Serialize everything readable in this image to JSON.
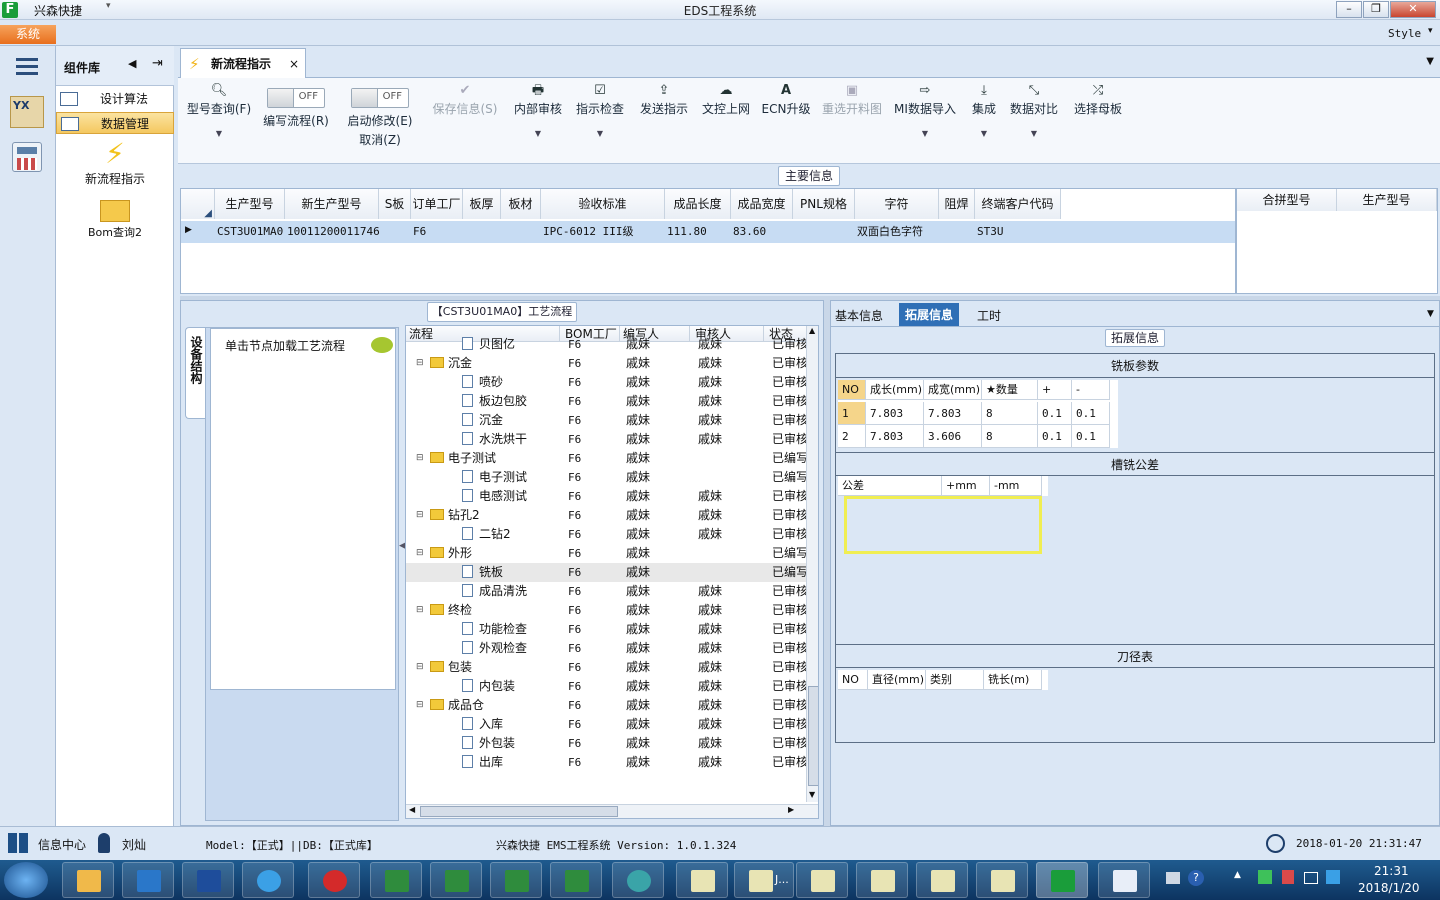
{
  "window": {
    "title": "EDS工程系统",
    "app_name": "兴森快捷",
    "style_label": "Style"
  },
  "menu": {
    "system": "系统"
  },
  "nav": {
    "header": "组件库",
    "items": [
      {
        "label": "设计算法"
      },
      {
        "label": "数据管理"
      }
    ],
    "tiles": [
      {
        "label": "新流程指示"
      },
      {
        "label": "Bom查询2"
      }
    ]
  },
  "tab": {
    "label": "新流程指示",
    "close": "×"
  },
  "toolbar": {
    "model_query": "型号查询(F)",
    "toggle_write": {
      "state": "OFF",
      "label": "编写流程(R)"
    },
    "toggle_start": {
      "state": "OFF",
      "label": "启动修改(E)",
      "sub": "取消(Z)"
    },
    "save": "保存信息(S)",
    "internal_review": "内部审核",
    "check": "指示检查",
    "send": "发送指示",
    "upload": "文控上网",
    "ecn": "ECN升级",
    "reselect": "重选开料图",
    "mi_import": "MI数据导入",
    "integrate": "集成",
    "compare": "数据对比",
    "select_board": "选择母板"
  },
  "main_info": {
    "title": "主要信息",
    "columns": [
      "生产型号",
      "新生产型号",
      "S板",
      "订单工厂",
      "板厚",
      "板材",
      "验收标准",
      "成品长度",
      "成品宽度",
      "PNL规格",
      "字符",
      "阻焊",
      "终端客户代码"
    ],
    "row": [
      "CST3U01MA0",
      "10011200011746",
      "",
      "F6",
      "",
      "",
      "IPC-6012 III级",
      "111.80",
      "83.60",
      "",
      "双面白色字符",
      "",
      "ST3U"
    ],
    "side_columns": [
      "合拼型号",
      "生产型号"
    ]
  },
  "process": {
    "title": "【CST3U01MA0】工艺流程",
    "side_tab": "设备结构",
    "hint": "单击节点加载工艺流程",
    "columns": [
      "流程",
      "BOM工厂",
      "编写人",
      "审核人",
      "状态"
    ],
    "rows": [
      {
        "name": "贝图亿",
        "level": 2,
        "type": "file",
        "bom": "F6",
        "writer": "戚妹",
        "reviewer": "戚妹",
        "status": "已审核"
      },
      {
        "name": "沉金",
        "level": 1,
        "type": "folder",
        "bom": "F6",
        "writer": "戚妹",
        "reviewer": "戚妹",
        "status": "已审核"
      },
      {
        "name": "喷砂",
        "level": 2,
        "type": "file",
        "bom": "F6",
        "writer": "戚妹",
        "reviewer": "戚妹",
        "status": "已审核"
      },
      {
        "name": "板边包胶",
        "level": 2,
        "type": "file",
        "bom": "F6",
        "writer": "戚妹",
        "reviewer": "戚妹",
        "status": "已审核"
      },
      {
        "name": "沉金",
        "level": 2,
        "type": "file",
        "bom": "F6",
        "writer": "戚妹",
        "reviewer": "戚妹",
        "status": "已审核"
      },
      {
        "name": "水洗烘干",
        "level": 2,
        "type": "file",
        "bom": "F6",
        "writer": "戚妹",
        "reviewer": "戚妹",
        "status": "已审核"
      },
      {
        "name": "电子测试",
        "level": 1,
        "type": "folder",
        "bom": "F6",
        "writer": "戚妹",
        "reviewer": "",
        "status": "已编写"
      },
      {
        "name": "电子测试",
        "level": 2,
        "type": "file",
        "bom": "F6",
        "writer": "戚妹",
        "reviewer": "",
        "status": "已编写"
      },
      {
        "name": "电感测试",
        "level": 2,
        "type": "file",
        "bom": "F6",
        "writer": "戚妹",
        "reviewer": "戚妹",
        "status": "已审核"
      },
      {
        "name": "钻孔2",
        "level": 1,
        "type": "folder",
        "bom": "F6",
        "writer": "戚妹",
        "reviewer": "戚妹",
        "status": "已审核"
      },
      {
        "name": "二钻2",
        "level": 2,
        "type": "file",
        "bom": "F6",
        "writer": "戚妹",
        "reviewer": "戚妹",
        "status": "已审核"
      },
      {
        "name": "外形",
        "level": 1,
        "type": "folder",
        "bom": "F6",
        "writer": "戚妹",
        "reviewer": "",
        "status": "已编写"
      },
      {
        "name": "铣板",
        "level": 2,
        "type": "file",
        "bom": "F6",
        "writer": "戚妹",
        "reviewer": "",
        "status": "已编写"
      },
      {
        "name": "成品清洗",
        "level": 2,
        "type": "file",
        "bom": "F6",
        "writer": "戚妹",
        "reviewer": "戚妹",
        "status": "已审核"
      },
      {
        "name": "终检",
        "level": 1,
        "type": "folder",
        "bom": "F6",
        "writer": "戚妹",
        "reviewer": "戚妹",
        "status": "已审核"
      },
      {
        "name": "功能检查",
        "level": 2,
        "type": "file",
        "bom": "F6",
        "writer": "戚妹",
        "reviewer": "戚妹",
        "status": "已审核"
      },
      {
        "name": "外观检查",
        "level": 2,
        "type": "file",
        "bom": "F6",
        "writer": "戚妹",
        "reviewer": "戚妹",
        "status": "已审核"
      },
      {
        "name": "包装",
        "level": 1,
        "type": "folder",
        "bom": "F6",
        "writer": "戚妹",
        "reviewer": "戚妹",
        "status": "已审核"
      },
      {
        "name": "内包装",
        "level": 2,
        "type": "file",
        "bom": "F6",
        "writer": "戚妹",
        "reviewer": "戚妹",
        "status": "已审核"
      },
      {
        "name": "成品仓",
        "level": 1,
        "type": "folder",
        "bom": "F6",
        "writer": "戚妹",
        "reviewer": "戚妹",
        "status": "已审核"
      },
      {
        "name": "入库",
        "level": 2,
        "type": "file",
        "bom": "F6",
        "writer": "戚妹",
        "reviewer": "戚妹",
        "status": "已审核"
      },
      {
        "name": "外包装",
        "level": 2,
        "type": "file",
        "bom": "F6",
        "writer": "戚妹",
        "reviewer": "戚妹",
        "status": "已审核"
      },
      {
        "name": "出库",
        "level": 2,
        "type": "file",
        "bom": "F6",
        "writer": "戚妹",
        "reviewer": "戚妹",
        "status": "已审核"
      }
    ]
  },
  "right_panel": {
    "tabs": [
      "基本信息",
      "拓展信息",
      "工时"
    ],
    "group_title": "拓展信息",
    "board_params": {
      "title": "铣板参数",
      "columns": [
        "NO",
        "成长(mm)",
        "成宽(mm)",
        "★数量",
        "+",
        "-"
      ],
      "rows": [
        [
          "1",
          "7.803",
          "7.803",
          "8",
          "0.1",
          "0.1"
        ],
        [
          "2",
          "7.803",
          "3.606",
          "8",
          "0.1",
          "0.1"
        ]
      ]
    },
    "tolerance": {
      "title": "槽铣公差",
      "columns": [
        "公差",
        "+mm",
        "-mm"
      ]
    },
    "tools": {
      "title": "刀径表",
      "columns": [
        "NO",
        "直径(mm)",
        "类别",
        "铣长(m)"
      ]
    }
  },
  "status": {
    "info_center": "信息中心",
    "user": "刘灿",
    "model_db": "Model:【正式】||DB:【正式库】",
    "version": "兴森快捷 EMS工程系统 Version: 1.0.1.324",
    "datetime": "2018-01-20 21:31:47"
  },
  "taskbar": {
    "time": "21:31",
    "date": "2018/1/20",
    "item_label": "J..."
  }
}
